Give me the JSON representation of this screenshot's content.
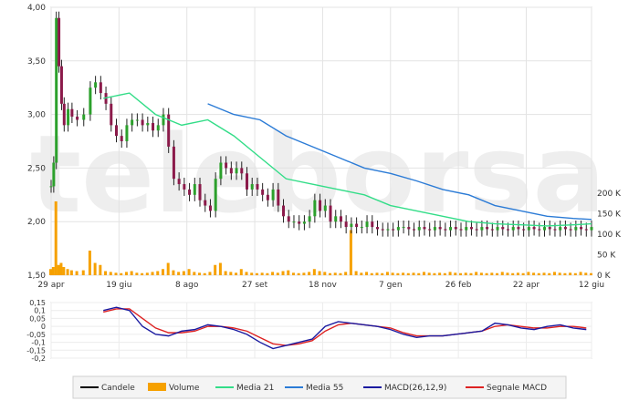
{
  "chart_data": [
    {
      "type": "line",
      "panel": "price",
      "y_ticks": [
        "4,00",
        "3,50",
        "3,00",
        "2,50",
        "2,00",
        "1,50"
      ],
      "y_values": [
        4.0,
        3.5,
        3.0,
        2.5,
        2.0,
        1.5
      ],
      "ylim": [
        1.5,
        4.0
      ],
      "volume_ticks": [
        "200 K",
        "150 K",
        "100 K",
        "50 K",
        "0 K"
      ],
      "volume_values": [
        200,
        150,
        100,
        50,
        0
      ],
      "x_labels": [
        "29 apr",
        "19 giu",
        "8 ago",
        "27 set",
        "18 nov",
        "7 gen",
        "26 feb",
        "22 apr",
        "12 giu"
      ],
      "watermark": "teleborsa",
      "grid": true,
      "colors": {
        "candle": "#000000",
        "volume": "#f6a100",
        "ma21": "#33dd88",
        "ma55": "#2b7bd6",
        "macd": "#1a1aa0",
        "signal": "#dd2222"
      },
      "series": [
        {
          "name": "Candele",
          "x": [
            0,
            2,
            4,
            6,
            8,
            10,
            13,
            16,
            20,
            25,
            30,
            34,
            38,
            42,
            46,
            50,
            54,
            58,
            62,
            66,
            70,
            74,
            78,
            82,
            86,
            90,
            94,
            98,
            102,
            106,
            110,
            114,
            118,
            122,
            126,
            130,
            134,
            138,
            142,
            146,
            150,
            154,
            158,
            162,
            166,
            170,
            174,
            178,
            182,
            186,
            190,
            194,
            198,
            202,
            206,
            210,
            214,
            218,
            222,
            226,
            230,
            234,
            238,
            242,
            246,
            250,
            254,
            258,
            262,
            266,
            270,
            274,
            278,
            282,
            286,
            290,
            294,
            298,
            302,
            306,
            310,
            314,
            318,
            322,
            326,
            330,
            334,
            338,
            342,
            346,
            350,
            354,
            358,
            362,
            366,
            370,
            374,
            378,
            382,
            386,
            390,
            394,
            398,
            402,
            406,
            410,
            414
          ],
          "y": [
            2.33,
            2.55,
            3.9,
            3.45,
            3.1,
            2.9,
            3.05,
            2.98,
            2.95,
            3.0,
            3.25,
            3.3,
            3.2,
            3.1,
            2.9,
            2.8,
            2.75,
            2.9,
            2.95,
            2.95,
            2.9,
            2.92,
            2.85,
            2.9,
            3.0,
            2.7,
            2.4,
            2.35,
            2.3,
            2.25,
            2.35,
            2.2,
            2.15,
            2.1,
            2.4,
            2.55,
            2.5,
            2.45,
            2.5,
            2.45,
            2.3,
            2.35,
            2.3,
            2.25,
            2.2,
            2.3,
            2.15,
            2.05,
            2.0,
            2.0,
            1.98,
            2.0,
            2.05,
            2.2,
            2.1,
            2.15,
            2.0,
            2.05,
            2.0,
            1.95,
            1.98,
            1.95,
            1.95,
            2.0,
            1.95,
            1.93,
            1.92,
            1.93,
            1.92,
            1.95,
            1.95,
            1.93,
            1.92,
            1.95,
            1.93,
            1.92,
            1.95,
            1.93,
            1.92,
            1.95,
            1.93,
            1.92,
            1.95,
            1.93,
            1.92,
            1.95,
            1.93,
            1.92,
            1.95,
            1.93,
            1.92,
            1.95,
            1.93,
            1.92,
            1.95,
            1.93,
            1.92,
            1.95,
            1.93,
            1.92,
            1.95,
            1.93,
            1.92,
            1.95,
            1.93,
            1.92,
            1.95
          ]
        },
        {
          "name": "Volume",
          "x": [
            0,
            2,
            4,
            6,
            8,
            10,
            13,
            16,
            20,
            25,
            30,
            34,
            38,
            42,
            46,
            50,
            54,
            58,
            62,
            66,
            70,
            74,
            78,
            82,
            86,
            90,
            94,
            98,
            102,
            106,
            110,
            114,
            118,
            122,
            126,
            130,
            134,
            138,
            142,
            146,
            150,
            154,
            158,
            162,
            166,
            170,
            174,
            178,
            182,
            186,
            190,
            194,
            198,
            202,
            206,
            210,
            214,
            218,
            222,
            226,
            230,
            234,
            238,
            242,
            246,
            250,
            254,
            258,
            262,
            266,
            270,
            274,
            278,
            282,
            286,
            290,
            294,
            298,
            302,
            306,
            310,
            314,
            318,
            322,
            326,
            330,
            334,
            338,
            342,
            346,
            350,
            354,
            358,
            362,
            366,
            370,
            374,
            378,
            382,
            386,
            390,
            394,
            398,
            402,
            406,
            410,
            414
          ],
          "values": [
            15,
            20,
            180,
            25,
            30,
            20,
            15,
            12,
            10,
            12,
            60,
            30,
            25,
            10,
            8,
            6,
            5,
            8,
            10,
            6,
            5,
            6,
            8,
            10,
            15,
            30,
            12,
            8,
            10,
            15,
            8,
            6,
            5,
            8,
            25,
            30,
            10,
            8,
            6,
            15,
            8,
            6,
            5,
            6,
            5,
            8,
            6,
            10,
            12,
            6,
            5,
            6,
            8,
            15,
            10,
            8,
            5,
            6,
            5,
            8,
            110,
            10,
            6,
            8,
            5,
            6,
            5,
            8,
            6,
            5,
            6,
            5,
            6,
            5,
            8,
            6,
            5,
            6,
            5,
            8,
            6,
            5,
            6,
            5,
            8,
            6,
            5,
            6,
            5,
            8,
            6,
            5,
            6,
            5,
            8,
            6,
            5,
            6,
            5,
            8,
            6,
            5,
            6,
            5,
            8,
            6,
            5
          ]
        },
        {
          "name": "Media 21",
          "x": [
            40,
            60,
            80,
            100,
            120,
            140,
            160,
            180,
            200,
            220,
            240,
            260,
            280,
            300,
            320,
            340,
            360,
            380,
            400,
            414
          ],
          "y": [
            3.15,
            3.2,
            3.0,
            2.9,
            2.95,
            2.8,
            2.6,
            2.4,
            2.35,
            2.3,
            2.25,
            2.15,
            2.1,
            2.05,
            2.0,
            1.98,
            1.97,
            1.96,
            1.97,
            1.98
          ]
        },
        {
          "name": "Media 55",
          "x": [
            120,
            140,
            160,
            180,
            200,
            220,
            240,
            260,
            280,
            300,
            320,
            340,
            360,
            380,
            400,
            414
          ],
          "y": [
            3.1,
            3.0,
            2.95,
            2.8,
            2.7,
            2.6,
            2.5,
            2.45,
            2.38,
            2.3,
            2.25,
            2.15,
            2.1,
            2.05,
            2.03,
            2.02
          ]
        }
      ]
    },
    {
      "type": "line",
      "panel": "macd",
      "y_ticks": [
        "0,15",
        "0,1",
        "0,05",
        "0",
        "-0,05",
        "-0,1",
        "-0,15",
        "-0,2"
      ],
      "y_values": [
        0.15,
        0.1,
        0.05,
        0,
        -0.05,
        -0.1,
        -0.15,
        -0.2
      ],
      "ylim": [
        -0.2,
        0.15
      ],
      "series": [
        {
          "name": "MACD(26,12,9)",
          "x": [
            40,
            50,
            60,
            70,
            80,
            90,
            100,
            110,
            120,
            130,
            140,
            150,
            160,
            170,
            180,
            190,
            200,
            210,
            220,
            230,
            240,
            250,
            260,
            270,
            280,
            290,
            300,
            310,
            320,
            330,
            340,
            350,
            360,
            370,
            380,
            390,
            400,
            410
          ],
          "y": [
            0.1,
            0.12,
            0.1,
            0.0,
            -0.05,
            -0.06,
            -0.03,
            -0.02,
            0.01,
            0.0,
            -0.02,
            -0.05,
            -0.1,
            -0.14,
            -0.12,
            -0.1,
            -0.08,
            0.0,
            0.03,
            0.02,
            0.01,
            0.0,
            -0.02,
            -0.05,
            -0.07,
            -0.06,
            -0.06,
            -0.05,
            -0.04,
            -0.03,
            0.02,
            0.01,
            -0.01,
            -0.02,
            0.0,
            0.01,
            -0.01,
            -0.02
          ]
        },
        {
          "name": "Segnale MACD",
          "x": [
            40,
            50,
            60,
            70,
            80,
            90,
            100,
            110,
            120,
            130,
            140,
            150,
            160,
            170,
            180,
            190,
            200,
            210,
            220,
            230,
            240,
            250,
            260,
            270,
            280,
            290,
            300,
            310,
            320,
            330,
            340,
            350,
            360,
            370,
            380,
            390,
            400,
            410
          ],
          "y": [
            0.09,
            0.11,
            0.11,
            0.05,
            -0.01,
            -0.04,
            -0.04,
            -0.03,
            0.0,
            0.0,
            -0.01,
            -0.03,
            -0.07,
            -0.11,
            -0.12,
            -0.11,
            -0.09,
            -0.03,
            0.01,
            0.02,
            0.01,
            0.0,
            -0.01,
            -0.04,
            -0.06,
            -0.06,
            -0.06,
            -0.05,
            -0.04,
            -0.03,
            0.0,
            0.01,
            0.0,
            -0.01,
            -0.01,
            0.0,
            0.0,
            -0.01
          ]
        }
      ]
    }
  ],
  "legend": {
    "items": [
      {
        "label": "Candele",
        "color": "#000000",
        "swatch": "line"
      },
      {
        "label": "Volume",
        "color": "#f6a100",
        "swatch": "box"
      },
      {
        "label": "Media 21",
        "color": "#33dd88",
        "swatch": "line"
      },
      {
        "label": "Media 55",
        "color": "#2b7bd6",
        "swatch": "line"
      },
      {
        "label": "MACD(26,12,9)",
        "color": "#1a1aa0",
        "swatch": "line"
      },
      {
        "label": "Segnale MACD",
        "color": "#dd2222",
        "swatch": "line"
      }
    ]
  }
}
